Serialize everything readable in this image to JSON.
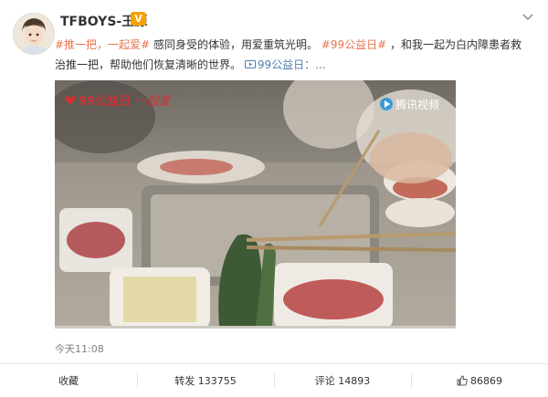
{
  "author": {
    "name": "TFBOYS-王源"
  },
  "post": {
    "segments": [
      {
        "type": "tag",
        "text": "#推一把，一起爱#"
      },
      {
        "type": "text",
        "text": "感同身受的体验，用爱重筑光明。"
      },
      {
        "type": "tag",
        "text": "#99公益日#"
      },
      {
        "type": "text",
        "text": "，和我一起为白内障患者救治推一把，帮助他们恢复清晰的世界。"
      },
      {
        "type": "link",
        "text": "99公益日：..."
      }
    ]
  },
  "video": {
    "brand_logo": "99公益日",
    "brand_script": "一起爱",
    "watermark": "腾讯视频",
    "progress": 0
  },
  "timestamp": "今天11:08",
  "actions": {
    "favorite": "收藏",
    "repost": "转发 133755",
    "comment": "评论 14893",
    "like": "86869"
  },
  "colors": {
    "tag": "#eb7350",
    "link": "#507daf",
    "badge": "#f7a000"
  },
  "icons": {
    "avatar": "avatar-image",
    "chevron": "chevron-down-icon",
    "like": "thumbs-up-icon",
    "badge": "vip-v-icon",
    "play": "play-icon",
    "heart": "heart-icon"
  }
}
